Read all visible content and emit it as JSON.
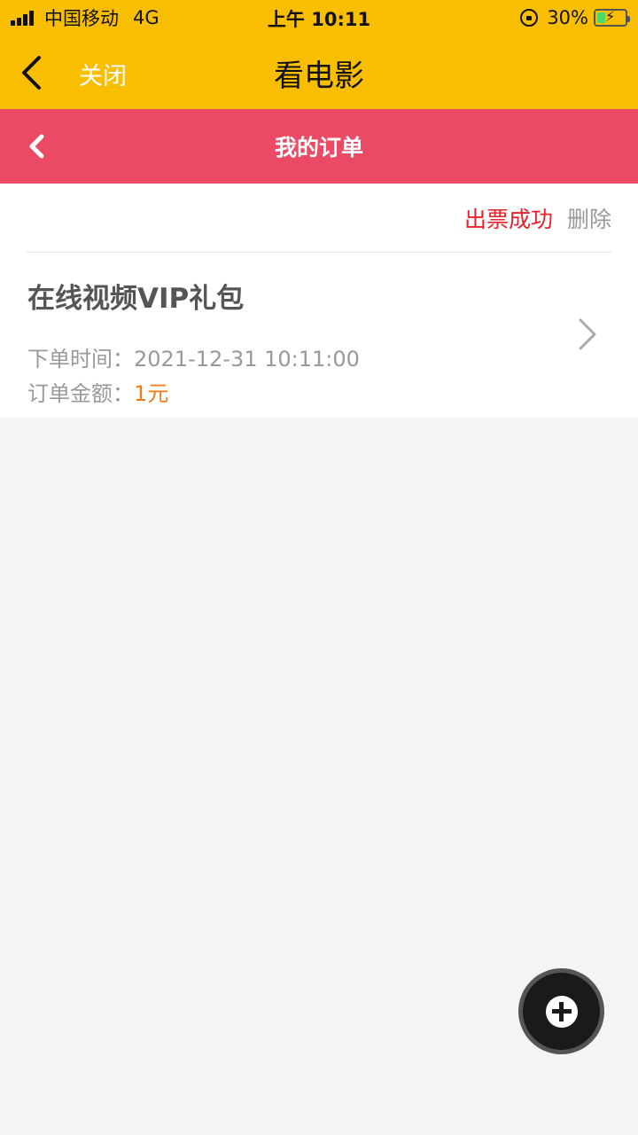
{
  "status_bar": {
    "carrier": "中国移动",
    "network": "4G",
    "time": "上午 10:11",
    "battery_percent": "30%"
  },
  "nav": {
    "close_label": "关闭",
    "title": "看电影"
  },
  "sub_header": {
    "title": "我的订单"
  },
  "order": {
    "status": "出票成功",
    "delete_label": "删除",
    "title": "在线视频VIP礼包",
    "time_label": "下单时间：",
    "time_value": "2021-12-31 10:11:00",
    "amount_label": "订单金额：",
    "amount_value": "1元"
  },
  "colors": {
    "top_bar": "#f9be00",
    "sub_header": "#eb4a64",
    "status_success": "#e8222a",
    "amount": "#f07b1b"
  },
  "icons": {
    "back": "chevron-left-icon",
    "sub_back": "chevron-left-icon",
    "detail": "chevron-right-icon",
    "fab": "plus-icon"
  }
}
